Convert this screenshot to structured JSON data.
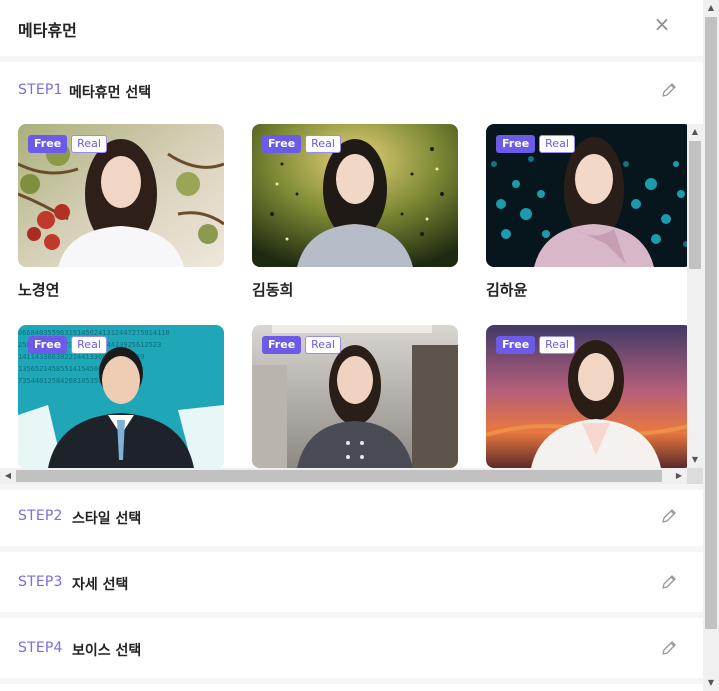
{
  "header": {
    "title": "메타휴먼",
    "close_label": "×"
  },
  "steps": [
    {
      "num": "STEP1",
      "title": "메타휴먼 선택"
    },
    {
      "num": "STEP2",
      "title": "스타일 선택"
    },
    {
      "num": "STEP3",
      "title": "자세 선택"
    },
    {
      "num": "STEP4",
      "title": "보이스 선택"
    }
  ],
  "badges": {
    "free": "Free",
    "real": "Real"
  },
  "avatars": [
    {
      "name": "노경연",
      "background": "apple-orchard"
    },
    {
      "name": "김동희",
      "background": "green-bokeh-glitter"
    },
    {
      "name": "김하윤",
      "background": "teal-light-strings"
    },
    {
      "name": "",
      "background": "cyan-digital-numbers"
    },
    {
      "name": "",
      "background": "modern-office-interior"
    },
    {
      "name": "",
      "background": "sunset-sky"
    }
  ],
  "colors": {
    "accent": "#6b5be6",
    "step_label": "#7b6ce0"
  },
  "icons": {
    "edit": "pencil-icon",
    "close": "close-icon"
  }
}
